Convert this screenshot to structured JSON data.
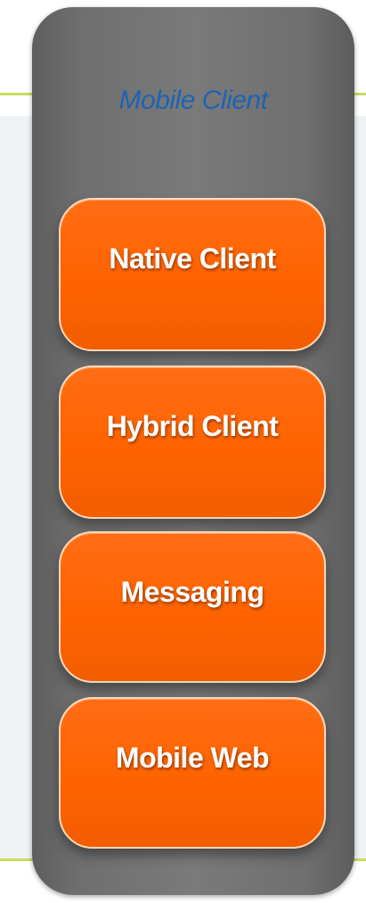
{
  "panel": {
    "title": "Mobile Client"
  },
  "blocks": [
    {
      "label": "Native Client"
    },
    {
      "label": "Hybrid Client"
    },
    {
      "label": "Messaging"
    },
    {
      "label": "Mobile Web"
    }
  ],
  "colors": {
    "panel": "#707070",
    "title": "#1e63b3",
    "block": "#ff6300",
    "accent_line": "#c8dc5a"
  }
}
